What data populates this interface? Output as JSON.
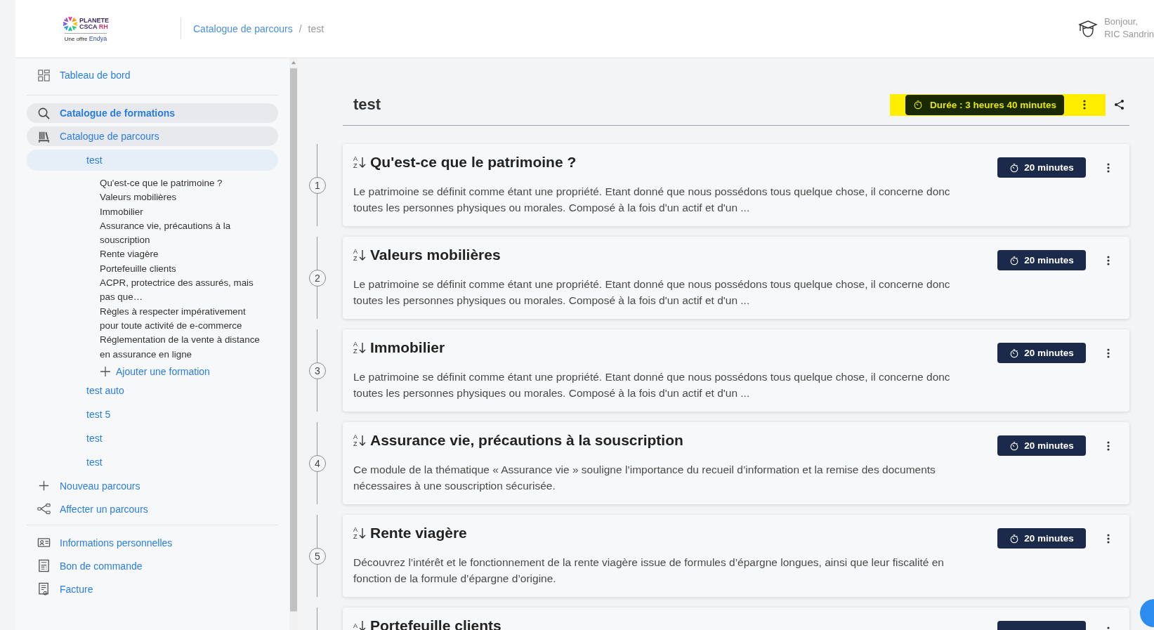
{
  "header": {
    "logo": {
      "word1": "PLANETE",
      "word2": "CSCA",
      "word3": "RH",
      "tagline_prefix": "Une offre",
      "tagline_brand": "Endya"
    },
    "breadcrumb": [
      {
        "label": "Catalogue de parcours",
        "selected": false
      },
      {
        "label": "test",
        "selected": true
      }
    ],
    "breadcrumb_separator": "/",
    "user": {
      "greeting": "Bonjour,",
      "name": "RIC Sandrin"
    }
  },
  "sidebar": {
    "groups": [
      [
        {
          "label": "Tableau de bord",
          "selected": false,
          "expanded": false
        }
      ],
      [
        {
          "label": "Catalogue de formations",
          "selected": true,
          "expanded": false
        },
        {
          "label": "Catalogue de parcours",
          "selected": false,
          "expanded": true,
          "children": [
            {
              "label": "test",
              "selected": true,
              "expanded": true,
              "add_label": "Ajouter une formation",
              "children": [
                {
                  "label": "Qu'est-ce que le patrimoine ?"
                },
                {
                  "label": "Valeurs mobilières"
                },
                {
                  "label": "Immobilier"
                },
                {
                  "label": "Assurance vie, précautions à la souscription"
                },
                {
                  "label": "Rente viagère"
                },
                {
                  "label": "Portefeuille clients"
                },
                {
                  "label": "ACPR, protectrice des assurés, mais pas que…"
                },
                {
                  "label": "Règles à respecter impérativement pour toute activité de e-commerce"
                },
                {
                  "label": "Réglementation de la vente à distance en assurance en ligne"
                }
              ]
            },
            {
              "label": "test auto",
              "selected": false,
              "expanded": false
            },
            {
              "label": "test 5",
              "selected": false,
              "expanded": false
            },
            {
              "label": "test",
              "selected": false,
              "expanded": false
            },
            {
              "label": "test",
              "selected": false,
              "expanded": false
            }
          ]
        },
        {
          "label": "Nouveau parcours",
          "selected": false,
          "expanded": false
        },
        {
          "label": "Affecter un parcours",
          "selected": false,
          "expanded": false
        }
      ],
      [
        {
          "label": "Informations personnelles",
          "selected": false,
          "expanded": false
        },
        {
          "label": "Bon de commande",
          "selected": false,
          "expanded": false
        },
        {
          "label": "Facture",
          "selected": false,
          "expanded": false
        }
      ]
    ]
  },
  "course": {
    "title": "test",
    "duration": "Durée : 3 heures 40 minutes",
    "modules": [
      {
        "step": "1",
        "sort": {
          "upper": "A",
          "lower": "Z"
        },
        "title": "Qu'est-ce que le patrimoine ?",
        "duration": "20 minutes",
        "description": "Le patrimoine se définit comme étant une propriété. Etant donné que nous possédons tous quelque chose, il concerne donc toutes les personnes physiques ou morales. Composé à la fois d'un actif et d'un ..."
      },
      {
        "step": "2",
        "sort": {
          "upper": "A",
          "lower": "Z"
        },
        "title": "Valeurs mobilières",
        "duration": "20 minutes",
        "description": "Le patrimoine se définit comme étant une propriété. Etant donné que nous possédons tous quelque chose, il concerne donc toutes les personnes physiques ou morales. Composé à la fois d'un actif et d'un ..."
      },
      {
        "step": "3",
        "sort": {
          "upper": "A",
          "lower": "Z"
        },
        "title": "Immobilier",
        "duration": "20 minutes",
        "description": "Le patrimoine se définit comme étant une propriété. Etant donné que nous possédons tous quelque chose, il concerne donc toutes les personnes physiques ou morales. Composé à la fois d'un actif et d'un ..."
      },
      {
        "step": "4",
        "sort": {
          "upper": "A",
          "lower": "Z"
        },
        "title": "Assurance vie, précautions à la souscription",
        "duration": "20 minutes",
        "description": "Ce module de la thématique « Assurance vie » souligne l’importance du recueil d’information et la remise des documents nécessaires à une souscription sécurisée."
      },
      {
        "step": "5",
        "sort": {
          "upper": "A",
          "lower": "Z"
        },
        "title": "Rente viagère",
        "duration": "20 minutes",
        "description": "Découvrez l’intérêt et le fonctionnement de la rente viagère issue de formules d’épargne longues, ainsi que leur fiscalité en fonction de la formule d’épargne d’origine."
      },
      {
        "sort": {
          "upper": "A"
        },
        "title": "Portefeuille clients"
      }
    ]
  }
}
